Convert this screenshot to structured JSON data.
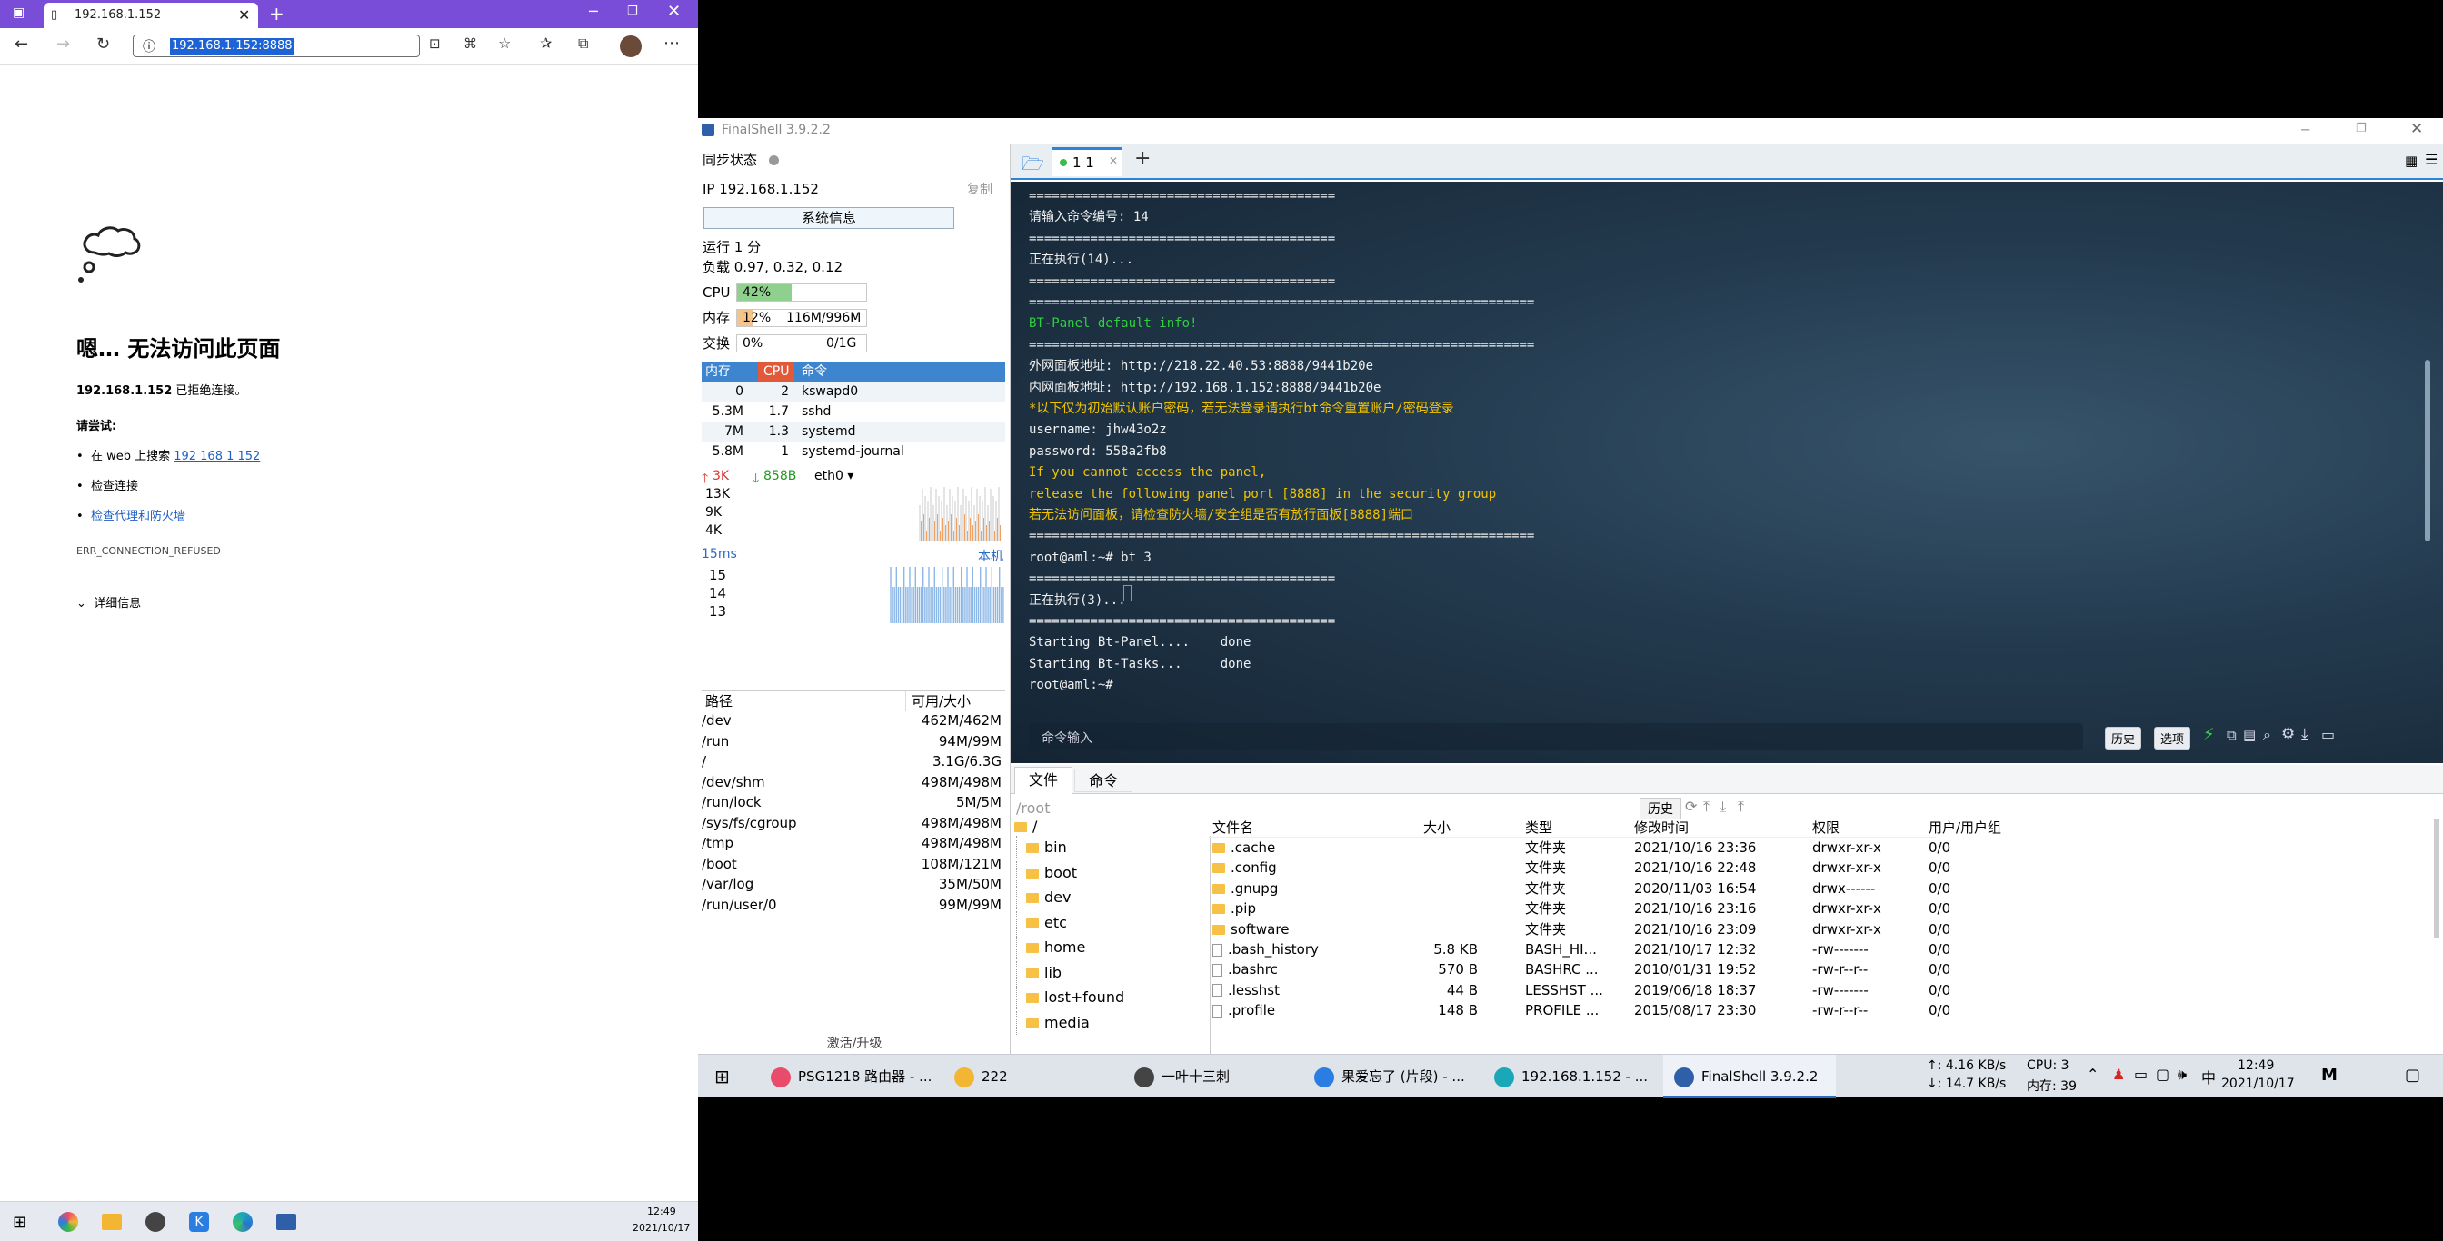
{
  "browser": {
    "tab_title": "192.168.1.152",
    "url": "192.168.1.152:8888",
    "error": {
      "title": "嗯… 无法访问此页面",
      "host": "192.168.1.152",
      "host_suffix": " 已拒绝连接。",
      "try_label": "请尝试:",
      "search_prefix": "在 web 上搜索 ",
      "search_link": "192 168 1 152",
      "check_conn": "检查连接",
      "check_proxy": "检查代理和防火墙",
      "code": "ERR_CONNECTION_REFUSED",
      "details": "详细信息"
    },
    "taskbar": {
      "time": "12:49",
      "date": "2021/10/17"
    }
  },
  "fs": {
    "title": "FinalShell 3.9.2.2",
    "sync_label": "同步状态",
    "ip": "IP 192.168.1.152",
    "copy": "复制",
    "sysinfo": "系统信息",
    "uptime": "运行 1 分",
    "load": "负载 0.97, 0.32, 0.12",
    "cpu": {
      "label": "CPU",
      "text": "42%",
      "pct": 0.42
    },
    "mem": {
      "label": "内存",
      "text": "12%",
      "detail": "116M/996M",
      "pct": 0.12
    },
    "swap": {
      "label": "交换",
      "text": "0%",
      "detail": "0/1G",
      "pct": 0
    },
    "proc_header": {
      "mem": "内存",
      "cpu": "CPU",
      "cmd": "命令"
    },
    "processes": [
      {
        "mem": "0",
        "cpu": "2",
        "cmd": "kswapd0"
      },
      {
        "mem": "5.3M",
        "cpu": "1.7",
        "cmd": "sshd"
      },
      {
        "mem": "7M",
        "cpu": "1.3",
        "cmd": "systemd"
      },
      {
        "mem": "5.8M",
        "cpu": "1",
        "cmd": "systemd-journal"
      }
    ],
    "net": {
      "up": "3K",
      "down": "858B",
      "iface": "eth0",
      "ticks": [
        "13K",
        "9K",
        "4K"
      ]
    },
    "ping": {
      "label": "15ms",
      "host": "本机",
      "ticks": [
        "15",
        "14",
        "13"
      ]
    },
    "disk_header": {
      "path": "路径",
      "size": "可用/大小"
    },
    "disks": [
      {
        "path": "/dev",
        "size": "462M/462M"
      },
      {
        "path": "/run",
        "size": "94M/99M"
      },
      {
        "path": "/",
        "size": "3.1G/6.3G"
      },
      {
        "path": "/dev/shm",
        "size": "498M/498M"
      },
      {
        "path": "/run/lock",
        "size": "5M/5M"
      },
      {
        "path": "/sys/fs/cgroup",
        "size": "498M/498M"
      },
      {
        "path": "/tmp",
        "size": "498M/498M"
      },
      {
        "path": "/boot",
        "size": "108M/121M"
      },
      {
        "path": "/var/log",
        "size": "35M/50M"
      },
      {
        "path": "/run/user/0",
        "size": "99M/99M"
      }
    ],
    "activate": "激活/升级",
    "session_tab": "1 1",
    "terminal_lines": [
      {
        "t": "========================================",
        "c": "#f0f0f0"
      },
      {
        "t": "请输入命令编号: 14",
        "c": "#f0f0f0"
      },
      {
        "t": "========================================",
        "c": "#f0f0f0"
      },
      {
        "t": "正在执行(14)...",
        "c": "#f0f0f0"
      },
      {
        "t": "========================================",
        "c": "#f0f0f0"
      },
      {
        "t": "==================================================================",
        "c": "#f0f0f0"
      },
      {
        "t": "BT-Panel default info!",
        "c": "#2fcf3f"
      },
      {
        "t": "==================================================================",
        "c": "#f0f0f0"
      },
      {
        "t": "外网面板地址: http://218.22.40.53:8888/9441b20e",
        "c": "#f0f0f0"
      },
      {
        "t": "内网面板地址: http://192.168.1.152:8888/9441b20e",
        "c": "#f0f0f0"
      },
      {
        "t": "*以下仅为初始默认账户密码，若无法登录请执行bt命令重置账户/密码登录",
        "c": "#f2c400"
      },
      {
        "t": "username: jhw43o2z",
        "c": "#f0f0f0"
      },
      {
        "t": "password: 558a2fb8",
        "c": "#f0f0f0"
      },
      {
        "t": "If you cannot access the panel,",
        "c": "#f2c400"
      },
      {
        "t": "release the following panel port [8888] in the security group",
        "c": "#f2c400"
      },
      {
        "t": "若无法访问面板，请检查防火墙/安全组是否有放行面板[8888]端口",
        "c": "#f2c400"
      },
      {
        "t": "==================================================================",
        "c": "#f0f0f0"
      },
      {
        "t": "root@aml:~# bt 3",
        "c": "#f0f0f0"
      },
      {
        "t": "========================================",
        "c": "#f0f0f0"
      },
      {
        "t": "正在执行(3)...",
        "c": "#f0f0f0"
      },
      {
        "t": "========================================",
        "c": "#f0f0f0"
      },
      {
        "t": "Starting Bt-Panel....    done",
        "c": "#f0f0f0"
      },
      {
        "t": "Starting Bt-Tasks...     done",
        "c": "#f0f0f0"
      },
      {
        "t": "root@aml:~# ",
        "c": "#f0f0f0"
      }
    ],
    "cmd_input": "命令输入",
    "history_btn": "历史",
    "options_btn": "选项",
    "bottom_tabs": [
      "文件",
      "命令"
    ],
    "path": "/root",
    "path_history": "历史",
    "tree_root": "/",
    "tree": [
      "bin",
      "boot",
      "dev",
      "etc",
      "home",
      "lib",
      "lost+found",
      "media"
    ],
    "file_headers": [
      "文件名",
      "大小",
      "类型",
      "修改时间",
      "权限",
      "用户/用户组"
    ],
    "files": [
      {
        "name": ".cache",
        "size": "",
        "type": "文件夹",
        "time": "2021/10/16 23:36",
        "perm": "drwxr-xr-x",
        "owner": "0/0",
        "dir": true
      },
      {
        "name": ".config",
        "size": "",
        "type": "文件夹",
        "time": "2021/10/16 22:48",
        "perm": "drwxr-xr-x",
        "owner": "0/0",
        "dir": true
      },
      {
        "name": ".gnupg",
        "size": "",
        "type": "文件夹",
        "time": "2020/11/03 16:54",
        "perm": "drwx------",
        "owner": "0/0",
        "dir": true
      },
      {
        "name": ".pip",
        "size": "",
        "type": "文件夹",
        "time": "2021/10/16 23:16",
        "perm": "drwxr-xr-x",
        "owner": "0/0",
        "dir": true
      },
      {
        "name": "software",
        "size": "",
        "type": "文件夹",
        "time": "2021/10/16 23:09",
        "perm": "drwxr-xr-x",
        "owner": "0/0",
        "dir": true
      },
      {
        "name": ".bash_history",
        "size": "5.8 KB",
        "type": "BASH_HI...",
        "time": "2021/10/17 12:32",
        "perm": "-rw-------",
        "owner": "0/0",
        "dir": false
      },
      {
        "name": ".bashrc",
        "size": "570 B",
        "type": "BASHRC ...",
        "time": "2010/01/31 19:52",
        "perm": "-rw-r--r--",
        "owner": "0/0",
        "dir": false
      },
      {
        "name": ".lesshst",
        "size": "44 B",
        "type": "LESSHST ...",
        "time": "2019/06/18 18:37",
        "perm": "-rw-------",
        "owner": "0/0",
        "dir": false
      },
      {
        "name": ".profile",
        "size": "148 B",
        "type": "PROFILE ...",
        "time": "2015/08/17 23:30",
        "perm": "-rw-r--r--",
        "owner": "0/0",
        "dir": false
      }
    ]
  },
  "taskbar": {
    "items": [
      {
        "label": "PSG1218 路由器 - ...",
        "color": "#e94b6a"
      },
      {
        "label": "222",
        "color": "#f2b632"
      },
      {
        "label": "一叶十三刺",
        "color": "#444"
      },
      {
        "label": "果爱忘了 (片段) - ...",
        "color": "#2a7de1"
      },
      {
        "label": "192.168.1.152 - ...",
        "color": "#1aa7b8"
      },
      {
        "label": "FinalShell 3.9.2.2",
        "color": "#2f5fa8"
      }
    ],
    "net_up": "↑: 4.16 KB/s",
    "net_down": "↓: 14.7 KB/s",
    "cpu": "CPU: 3",
    "mem": "内存: 39",
    "ime": "中",
    "time": "12:49",
    "date": "2021/10/17"
  }
}
